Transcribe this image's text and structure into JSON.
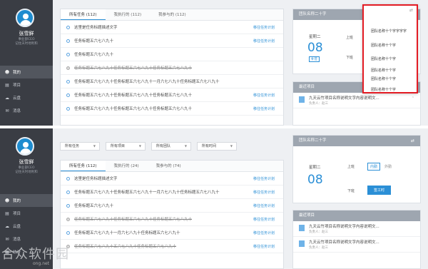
{
  "sidebar": {
    "name": "张雪鲜",
    "role": "事业部CEO",
    "bio": "记住天时地利和",
    "items": [
      {
        "label": "我的",
        "icon": "user-icon"
      },
      {
        "label": "项目",
        "icon": "folder-icon"
      },
      {
        "label": "云盘",
        "icon": "cloud-icon"
      },
      {
        "label": "消息",
        "icon": "chat-icon"
      },
      {
        "label": "统计",
        "icon": "chart-icon"
      }
    ]
  },
  "top": {
    "tabs": [
      "所有任务 (112)",
      "我执行的 (112)",
      "我参与的 (112)"
    ],
    "tasks": [
      {
        "text": "这里是任务标题描述文字",
        "link": "移往任务计划",
        "done": false
      },
      {
        "text": "任务标题五六七八九十",
        "link": "移往任务计划",
        "done": false
      },
      {
        "text": "任务标题五六七八九十",
        "link": "",
        "done": false
      },
      {
        "text": "任务标题五六七八九十任务标题五六七八九十任务标题五六七八九十",
        "link": "",
        "done": true
      },
      {
        "text": "任务标题五六七八九十任务标题五六七八九十一月六七八九十任务标题五六七八九十",
        "link": "",
        "done": false
      },
      {
        "text": "任务标题五六七八九十任务标题五六七八九十任务标题五六七八九十",
        "link": "移往任务计划",
        "done": false
      },
      {
        "text": "任务标题五六七八九十任务标题五六七八九十任务标题五六七八九十",
        "link": "移往任务计划",
        "done": false
      }
    ],
    "team": "团队名称二十字",
    "weekday": "星期二",
    "date": "08",
    "badge": "补签",
    "clock_in": "上班",
    "clock_out": "下班",
    "dropdown": [
      "团队名称十个字字字字",
      "团队名称十个字",
      "团队名称十个字",
      "团队名称十个字",
      "团队名称十个字",
      "团队名称十个字"
    ],
    "recent_title": "最近项目",
    "recent": [
      {
        "name": "九天云竹项目名称说明文字内容说明文...",
        "manager": "负责人：赵三"
      }
    ]
  },
  "bottom": {
    "filters": [
      "所有任务",
      "所有项目",
      "所有团队",
      "所有时间"
    ],
    "tabs": [
      "所有任务 (112)",
      "我执行的 (24)",
      "我参与的 (74)"
    ],
    "tasks": [
      {
        "text": "这里是任务标题描述文字",
        "link": "移往任务计划",
        "done": false
      },
      {
        "text": "任务标题五六七八九十任务标题五六七八九十一月六七八九十任务标题五六七八九十",
        "link": "移往任务计划",
        "done": false
      },
      {
        "text": "任务标题五六七八九十",
        "link": "移往任务计划",
        "done": false
      },
      {
        "text": "任务标题五六七八九十任务标题五六七八九十任务标题五六七八九十",
        "link": "移往任务计划",
        "done": true
      },
      {
        "text": "任务标题五六七八九十一月六七八九十任务标题五六七八九十",
        "link": "移往任务计划",
        "done": false
      },
      {
        "text": "任务标题五六七八九十五六七八九十任务标题五六七八九十",
        "link": "移往任务计划",
        "done": true
      }
    ],
    "team": "团队名称二十字",
    "weekday": "星期二",
    "date": "08",
    "clock_in": "上班",
    "clock_out": "下班",
    "pill_in": "内勤",
    "pill_out": "外勤",
    "clock_btn": "签工时",
    "recent_title": "最近项目",
    "recent": [
      {
        "name": "九天云竹项目名称说明文字内容说明文...",
        "manager": "负责人：赵三"
      },
      {
        "name": "九天云竹项目名称说明文字内容说明文...",
        "manager": "负责人：赵三"
      }
    ]
  },
  "watermark": {
    "text": "合众软件园",
    "sub": "ong.net"
  }
}
